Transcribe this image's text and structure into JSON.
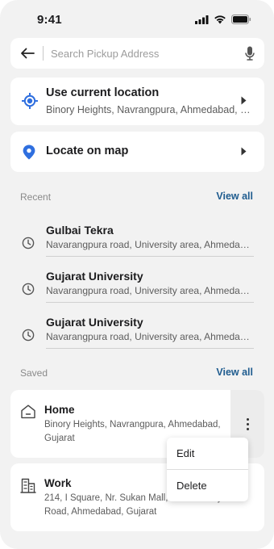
{
  "status_bar": {
    "time": "9:41"
  },
  "search": {
    "placeholder": "Search Pickup Address",
    "value": ""
  },
  "current_location": {
    "title": "Use current location",
    "subtitle": "Binory Heights, Navrangpura, Ahmedabad, Gujarat"
  },
  "locate_on_map": {
    "title": "Locate on map"
  },
  "recent": {
    "label": "Recent",
    "view_all": "View all",
    "items": [
      {
        "title": "Gulbai Tekra",
        "subtitle": "Navarangpura road, University area, Ahmedabad, Gujarat"
      },
      {
        "title": "Gujarat University",
        "subtitle": "Navarangpura road, University area, Ahmedabad, Gujarat"
      },
      {
        "title": "Gujarat University",
        "subtitle": "Navarangpura road, University area, Ahmedabad, Gujarat"
      }
    ]
  },
  "saved": {
    "label": "Saved",
    "view_all": "View all",
    "items": [
      {
        "title": "Home",
        "address": "Binory Heights, Navrangpura, Ahmedabad, Gujarat"
      },
      {
        "title": "Work",
        "address": "214, I Square, Nr. Sukan Mall, Science City Road, Ahmedabad, Gujarat"
      }
    ]
  },
  "menu": {
    "edit": "Edit",
    "delete": "Delete"
  },
  "colors": {
    "accent_blue": "#2f6fdf",
    "link_blue": "#1f5c8f",
    "background": "#f2f2f2",
    "card": "#ffffff"
  }
}
